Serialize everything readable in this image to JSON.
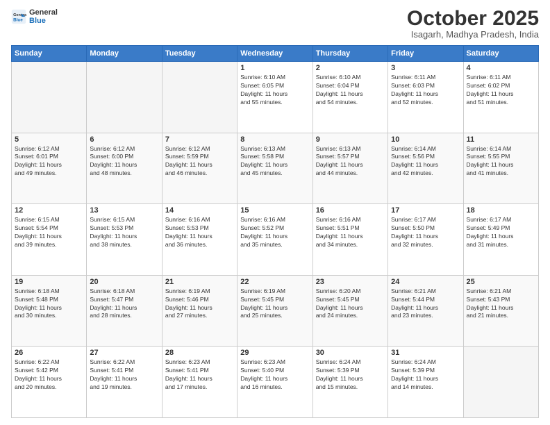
{
  "header": {
    "logo_line1": "General",
    "logo_line2": "Blue",
    "month_title": "October 2025",
    "location": "Isagarh, Madhya Pradesh, India"
  },
  "days_of_week": [
    "Sunday",
    "Monday",
    "Tuesday",
    "Wednesday",
    "Thursday",
    "Friday",
    "Saturday"
  ],
  "weeks": [
    [
      {
        "day": "",
        "data": ""
      },
      {
        "day": "",
        "data": ""
      },
      {
        "day": "",
        "data": ""
      },
      {
        "day": "1",
        "data": "Sunrise: 6:10 AM\nSunset: 6:05 PM\nDaylight: 11 hours\nand 55 minutes."
      },
      {
        "day": "2",
        "data": "Sunrise: 6:10 AM\nSunset: 6:04 PM\nDaylight: 11 hours\nand 54 minutes."
      },
      {
        "day": "3",
        "data": "Sunrise: 6:11 AM\nSunset: 6:03 PM\nDaylight: 11 hours\nand 52 minutes."
      },
      {
        "day": "4",
        "data": "Sunrise: 6:11 AM\nSunset: 6:02 PM\nDaylight: 11 hours\nand 51 minutes."
      }
    ],
    [
      {
        "day": "5",
        "data": "Sunrise: 6:12 AM\nSunset: 6:01 PM\nDaylight: 11 hours\nand 49 minutes."
      },
      {
        "day": "6",
        "data": "Sunrise: 6:12 AM\nSunset: 6:00 PM\nDaylight: 11 hours\nand 48 minutes."
      },
      {
        "day": "7",
        "data": "Sunrise: 6:12 AM\nSunset: 5:59 PM\nDaylight: 11 hours\nand 46 minutes."
      },
      {
        "day": "8",
        "data": "Sunrise: 6:13 AM\nSunset: 5:58 PM\nDaylight: 11 hours\nand 45 minutes."
      },
      {
        "day": "9",
        "data": "Sunrise: 6:13 AM\nSunset: 5:57 PM\nDaylight: 11 hours\nand 44 minutes."
      },
      {
        "day": "10",
        "data": "Sunrise: 6:14 AM\nSunset: 5:56 PM\nDaylight: 11 hours\nand 42 minutes."
      },
      {
        "day": "11",
        "data": "Sunrise: 6:14 AM\nSunset: 5:55 PM\nDaylight: 11 hours\nand 41 minutes."
      }
    ],
    [
      {
        "day": "12",
        "data": "Sunrise: 6:15 AM\nSunset: 5:54 PM\nDaylight: 11 hours\nand 39 minutes."
      },
      {
        "day": "13",
        "data": "Sunrise: 6:15 AM\nSunset: 5:53 PM\nDaylight: 11 hours\nand 38 minutes."
      },
      {
        "day": "14",
        "data": "Sunrise: 6:16 AM\nSunset: 5:53 PM\nDaylight: 11 hours\nand 36 minutes."
      },
      {
        "day": "15",
        "data": "Sunrise: 6:16 AM\nSunset: 5:52 PM\nDaylight: 11 hours\nand 35 minutes."
      },
      {
        "day": "16",
        "data": "Sunrise: 6:16 AM\nSunset: 5:51 PM\nDaylight: 11 hours\nand 34 minutes."
      },
      {
        "day": "17",
        "data": "Sunrise: 6:17 AM\nSunset: 5:50 PM\nDaylight: 11 hours\nand 32 minutes."
      },
      {
        "day": "18",
        "data": "Sunrise: 6:17 AM\nSunset: 5:49 PM\nDaylight: 11 hours\nand 31 minutes."
      }
    ],
    [
      {
        "day": "19",
        "data": "Sunrise: 6:18 AM\nSunset: 5:48 PM\nDaylight: 11 hours\nand 30 minutes."
      },
      {
        "day": "20",
        "data": "Sunrise: 6:18 AM\nSunset: 5:47 PM\nDaylight: 11 hours\nand 28 minutes."
      },
      {
        "day": "21",
        "data": "Sunrise: 6:19 AM\nSunset: 5:46 PM\nDaylight: 11 hours\nand 27 minutes."
      },
      {
        "day": "22",
        "data": "Sunrise: 6:19 AM\nSunset: 5:45 PM\nDaylight: 11 hours\nand 25 minutes."
      },
      {
        "day": "23",
        "data": "Sunrise: 6:20 AM\nSunset: 5:45 PM\nDaylight: 11 hours\nand 24 minutes."
      },
      {
        "day": "24",
        "data": "Sunrise: 6:21 AM\nSunset: 5:44 PM\nDaylight: 11 hours\nand 23 minutes."
      },
      {
        "day": "25",
        "data": "Sunrise: 6:21 AM\nSunset: 5:43 PM\nDaylight: 11 hours\nand 21 minutes."
      }
    ],
    [
      {
        "day": "26",
        "data": "Sunrise: 6:22 AM\nSunset: 5:42 PM\nDaylight: 11 hours\nand 20 minutes."
      },
      {
        "day": "27",
        "data": "Sunrise: 6:22 AM\nSunset: 5:41 PM\nDaylight: 11 hours\nand 19 minutes."
      },
      {
        "day": "28",
        "data": "Sunrise: 6:23 AM\nSunset: 5:41 PM\nDaylight: 11 hours\nand 17 minutes."
      },
      {
        "day": "29",
        "data": "Sunrise: 6:23 AM\nSunset: 5:40 PM\nDaylight: 11 hours\nand 16 minutes."
      },
      {
        "day": "30",
        "data": "Sunrise: 6:24 AM\nSunset: 5:39 PM\nDaylight: 11 hours\nand 15 minutes."
      },
      {
        "day": "31",
        "data": "Sunrise: 6:24 AM\nSunset: 5:39 PM\nDaylight: 11 hours\nand 14 minutes."
      },
      {
        "day": "",
        "data": ""
      }
    ]
  ]
}
